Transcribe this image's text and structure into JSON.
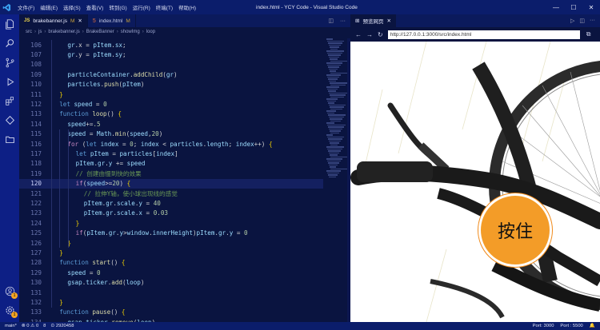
{
  "titlebar": {
    "menu": [
      "文件(F)",
      "编辑(E)",
      "选择(S)",
      "查看(V)",
      "转到(G)",
      "运行(R)",
      "终端(T)",
      "帮助(H)"
    ],
    "title": "index.html - YCY Code - Visual Studio Code",
    "controls": [
      "—",
      "☐",
      "✕"
    ]
  },
  "editor": {
    "tabs": [
      {
        "icon": "JS",
        "label": "brakebanner.js",
        "modified": "M"
      },
      {
        "icon": "5",
        "label": "index.html",
        "modified": "M"
      }
    ],
    "breadcrumb": [
      "src",
      "js",
      "brakebanner.js",
      "BrakeBanner",
      "showImg",
      "loop"
    ],
    "lines": [
      {
        "n": "106",
        "indent": 2,
        "tokens": [
          [
            "v",
            "gr"
          ],
          [
            "p",
            ".x = "
          ],
          [
            "v",
            "pItem"
          ],
          [
            "p",
            "."
          ],
          [
            "v",
            "sx"
          ],
          [
            "p",
            ";"
          ]
        ]
      },
      {
        "n": "107",
        "indent": 2,
        "tokens": [
          [
            "v",
            "gr"
          ],
          [
            "p",
            ".y = "
          ],
          [
            "v",
            "pItem"
          ],
          [
            "p",
            "."
          ],
          [
            "v",
            "sy"
          ],
          [
            "p",
            ";"
          ]
        ]
      },
      {
        "n": "108",
        "indent": 0,
        "tokens": []
      },
      {
        "n": "109",
        "indent": 2,
        "tokens": [
          [
            "v",
            "particleContainer"
          ],
          [
            "p",
            "."
          ],
          [
            "f",
            "addChild"
          ],
          [
            "p",
            "("
          ],
          [
            "v",
            "gr"
          ],
          [
            "p",
            ")"
          ]
        ]
      },
      {
        "n": "110",
        "indent": 2,
        "tokens": [
          [
            "v",
            "particles"
          ],
          [
            "p",
            "."
          ],
          [
            "f",
            "push"
          ],
          [
            "p",
            "("
          ],
          [
            "v",
            "pItem"
          ],
          [
            "p",
            ")"
          ]
        ]
      },
      {
        "n": "111",
        "indent": 1,
        "tokens": [
          [
            "y",
            "}"
          ]
        ]
      },
      {
        "n": "112",
        "indent": 1,
        "tokens": [
          [
            "k",
            "let "
          ],
          [
            "v",
            "speed"
          ],
          [
            "p",
            " = "
          ],
          [
            "n",
            "0"
          ]
        ]
      },
      {
        "n": "113",
        "indent": 1,
        "tokens": [
          [
            "k",
            "function "
          ],
          [
            "f",
            "loop"
          ],
          [
            "p",
            "() "
          ],
          [
            "y",
            "{"
          ]
        ]
      },
      {
        "n": "114",
        "indent": 2,
        "tokens": [
          [
            "v",
            "speed"
          ],
          [
            "p",
            "+="
          ],
          [
            "n",
            ".5"
          ]
        ]
      },
      {
        "n": "115",
        "indent": 2,
        "tokens": [
          [
            "v",
            "speed"
          ],
          [
            "p",
            " = "
          ],
          [
            "v",
            "Math"
          ],
          [
            "p",
            "."
          ],
          [
            "f",
            "min"
          ],
          [
            "p",
            "("
          ],
          [
            "v",
            "speed"
          ],
          [
            "p",
            ","
          ],
          [
            "n",
            "20"
          ],
          [
            "p",
            ")"
          ]
        ]
      },
      {
        "n": "116",
        "indent": 2,
        "tokens": [
          [
            "ctl",
            "for "
          ],
          [
            "p",
            "("
          ],
          [
            "k",
            "let "
          ],
          [
            "v",
            "index"
          ],
          [
            "p",
            " = "
          ],
          [
            "n",
            "0"
          ],
          [
            "p",
            "; "
          ],
          [
            "v",
            "index"
          ],
          [
            "p",
            " < "
          ],
          [
            "v",
            "particles"
          ],
          [
            "p",
            "."
          ],
          [
            "v",
            "length"
          ],
          [
            "p",
            "; "
          ],
          [
            "v",
            "index"
          ],
          [
            "p",
            "++) "
          ],
          [
            "y",
            "{"
          ]
        ]
      },
      {
        "n": "117",
        "indent": 3,
        "tokens": [
          [
            "k",
            "let "
          ],
          [
            "v",
            "pItem"
          ],
          [
            "p",
            " = "
          ],
          [
            "v",
            "particles"
          ],
          [
            "p",
            "["
          ],
          [
            "v",
            "index"
          ],
          [
            "p",
            "]"
          ]
        ]
      },
      {
        "n": "118",
        "indent": 3,
        "tokens": [
          [
            "v",
            "pItem"
          ],
          [
            "p",
            "."
          ],
          [
            "v",
            "gr"
          ],
          [
            "p",
            "."
          ],
          [
            "v",
            "y"
          ],
          [
            "p",
            " += "
          ],
          [
            "v",
            "speed"
          ]
        ]
      },
      {
        "n": "119",
        "indent": 3,
        "tokens": [
          [
            "c",
            "// 创建由慢到快的效果"
          ]
        ]
      },
      {
        "n": "120",
        "indent": 3,
        "tokens": [
          [
            "ctl",
            "if"
          ],
          [
            "p",
            "("
          ],
          [
            "v",
            "speed"
          ],
          [
            "p",
            ">="
          ],
          [
            "n",
            "20"
          ],
          [
            "p",
            ") "
          ],
          [
            "y",
            "{"
          ]
        ],
        "current": true
      },
      {
        "n": "121",
        "indent": 4,
        "tokens": [
          [
            "c",
            "// 拉伸Y轴，使小球出现线的感觉"
          ]
        ]
      },
      {
        "n": "122",
        "indent": 4,
        "tokens": [
          [
            "v",
            "pItem"
          ],
          [
            "p",
            "."
          ],
          [
            "v",
            "gr"
          ],
          [
            "p",
            "."
          ],
          [
            "v",
            "scale"
          ],
          [
            "p",
            "."
          ],
          [
            "v",
            "y"
          ],
          [
            "p",
            " = "
          ],
          [
            "n",
            "40"
          ]
        ]
      },
      {
        "n": "123",
        "indent": 4,
        "tokens": [
          [
            "v",
            "pItem"
          ],
          [
            "p",
            "."
          ],
          [
            "v",
            "gr"
          ],
          [
            "p",
            "."
          ],
          [
            "v",
            "scale"
          ],
          [
            "p",
            "."
          ],
          [
            "v",
            "x"
          ],
          [
            "p",
            " = "
          ],
          [
            "n",
            "0.03"
          ]
        ]
      },
      {
        "n": "124",
        "indent": 3,
        "tokens": [
          [
            "y",
            "}"
          ]
        ]
      },
      {
        "n": "125",
        "indent": 3,
        "tokens": [
          [
            "ctl",
            "if"
          ],
          [
            "p",
            "("
          ],
          [
            "v",
            "pItem"
          ],
          [
            "p",
            "."
          ],
          [
            "v",
            "gr"
          ],
          [
            "p",
            "."
          ],
          [
            "v",
            "y"
          ],
          [
            "p",
            ">"
          ],
          [
            "v",
            "window"
          ],
          [
            "p",
            "."
          ],
          [
            "v",
            "innerHeight"
          ],
          [
            "p",
            ")"
          ],
          [
            "v",
            "pItem"
          ],
          [
            "p",
            "."
          ],
          [
            "v",
            "gr"
          ],
          [
            "p",
            "."
          ],
          [
            "v",
            "y"
          ],
          [
            "p",
            " = "
          ],
          [
            "n",
            "0"
          ]
        ]
      },
      {
        "n": "126",
        "indent": 2,
        "tokens": [
          [
            "y",
            "}"
          ]
        ]
      },
      {
        "n": "127",
        "indent": 1,
        "tokens": [
          [
            "y",
            "}"
          ]
        ]
      },
      {
        "n": "128",
        "indent": 1,
        "tokens": [
          [
            "k",
            "function "
          ],
          [
            "f",
            "start"
          ],
          [
            "p",
            "() "
          ],
          [
            "y",
            "{"
          ]
        ]
      },
      {
        "n": "129",
        "indent": 2,
        "tokens": [
          [
            "v",
            "speed"
          ],
          [
            "p",
            " = "
          ],
          [
            "n",
            "0"
          ]
        ]
      },
      {
        "n": "130",
        "indent": 2,
        "tokens": [
          [
            "v",
            "gsap"
          ],
          [
            "p",
            "."
          ],
          [
            "v",
            "ticker"
          ],
          [
            "p",
            "."
          ],
          [
            "f",
            "add"
          ],
          [
            "p",
            "("
          ],
          [
            "v",
            "loop"
          ],
          [
            "p",
            ")"
          ]
        ]
      },
      {
        "n": "131",
        "indent": 0,
        "tokens": []
      },
      {
        "n": "132",
        "indent": 1,
        "tokens": [
          [
            "y",
            "}"
          ]
        ]
      },
      {
        "n": "133",
        "indent": 1,
        "tokens": [
          [
            "k",
            "function "
          ],
          [
            "f",
            "pause"
          ],
          [
            "p",
            "() "
          ],
          [
            "y",
            "{"
          ]
        ]
      },
      {
        "n": "134",
        "indent": 2,
        "tokens": [
          [
            "v",
            "gsap"
          ],
          [
            "p",
            "."
          ],
          [
            "v",
            "ticker"
          ],
          [
            "p",
            "."
          ],
          [
            "f",
            "remove"
          ],
          [
            "p",
            "("
          ],
          [
            "v",
            "loop"
          ],
          [
            "p",
            ")"
          ]
        ]
      }
    ]
  },
  "browser": {
    "tab_label": "预览网页",
    "url": "http://127.0.0.1:3000/src/index.html",
    "press_label": "按住"
  },
  "status": {
    "left": [
      "main*",
      "⊗ 0 ⚠ 0",
      "8",
      "⊙ 2920458"
    ],
    "right": [
      "Port: 3000",
      "Port : 5500"
    ]
  },
  "colors": {
    "titlebar": "#0b1d6b",
    "activity": "#0d1f85",
    "editor_bg": "#0a1440",
    "accent": "#f39c28"
  }
}
